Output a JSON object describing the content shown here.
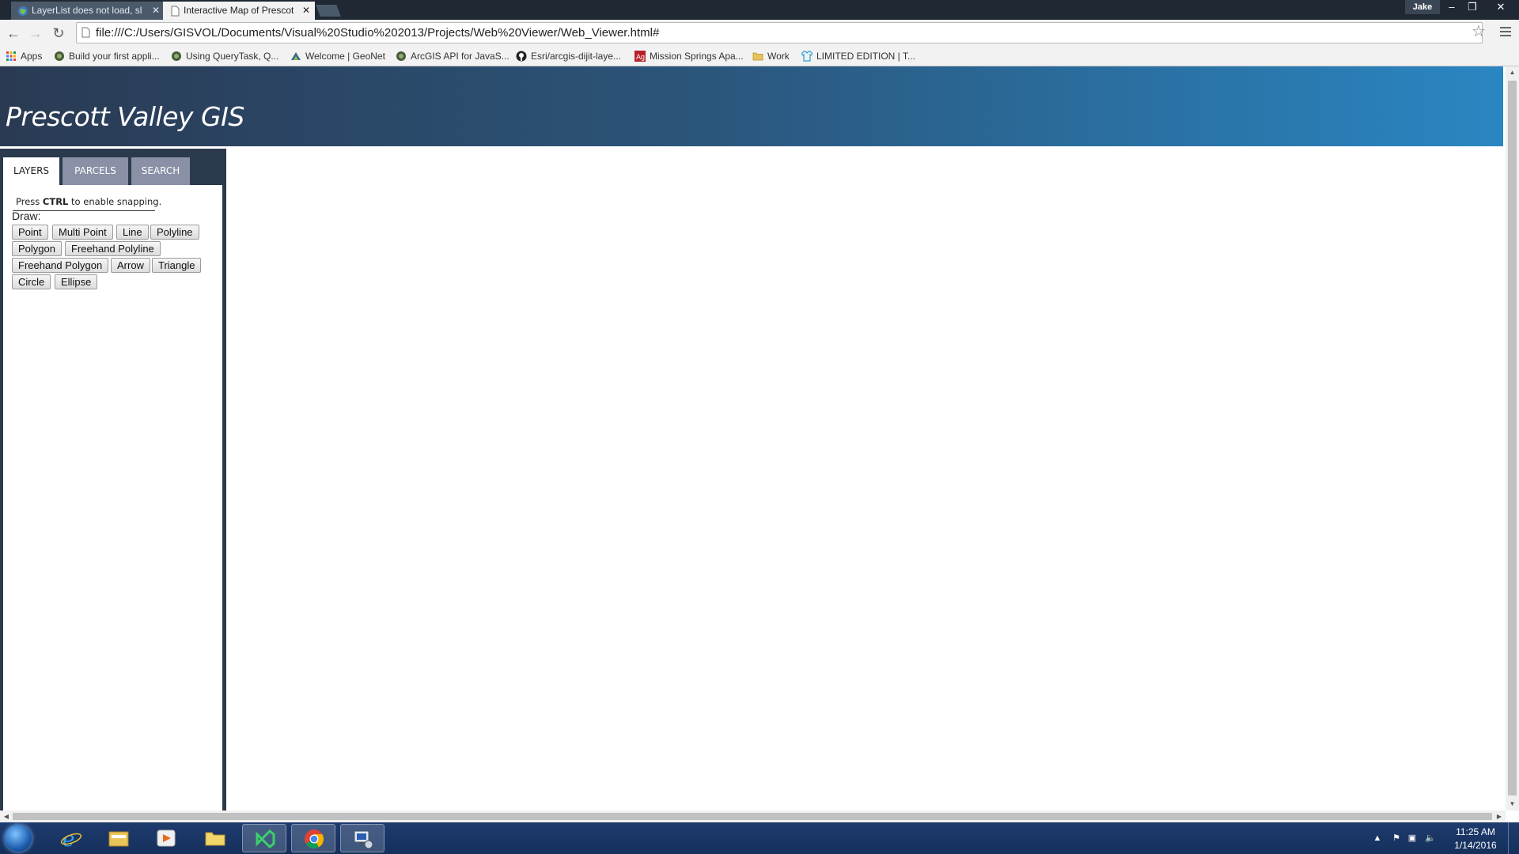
{
  "browser": {
    "tabs": [
      {
        "label": "LayerList does not load, sl"
      },
      {
        "label": "Interactive Map of Prescot"
      }
    ],
    "user": "Jake",
    "url": "file:///C:/Users/GISVOL/Documents/Visual%20Studio%202013/Projects/Web%20Viewer/Web_Viewer.html#",
    "bookmarks": [
      {
        "label": "Apps"
      },
      {
        "label": "Build your first appli..."
      },
      {
        "label": "Using QueryTask, Q..."
      },
      {
        "label": "Welcome | GeoNet"
      },
      {
        "label": "ArcGIS API for JavaS..."
      },
      {
        "label": "Esri/arcgis-dijit-laye..."
      },
      {
        "label": "Mission Springs Apa..."
      },
      {
        "label": "Work"
      },
      {
        "label": "LIMITED EDITION | T..."
      }
    ]
  },
  "page": {
    "title": "Prescott Valley GIS",
    "tabs": [
      {
        "label": "LAYERS"
      },
      {
        "label": "PARCELS"
      },
      {
        "label": "SEARCH"
      }
    ],
    "snap_note": {
      "before": "Press ",
      "key": "CTRL",
      "after": " to enable snapping."
    },
    "draw_label": "Draw:",
    "draw_buttons": [
      {
        "label": "Point"
      },
      {
        "label": "Multi Point"
      },
      {
        "label": "Line"
      },
      {
        "label": "Polyline"
      },
      {
        "label": "Polygon"
      },
      {
        "label": "Freehand Polyline"
      },
      {
        "label": "Freehand Polygon"
      },
      {
        "label": "Arrow"
      },
      {
        "label": "Triangle"
      },
      {
        "label": "Circle"
      },
      {
        "label": "Ellipse"
      }
    ]
  },
  "taskbar": {
    "time": "11:25 AM",
    "date": "1/14/2016"
  },
  "colors": {
    "header_start": "#2a3a53",
    "header_end": "#2a86c2",
    "sidebar": "#2b3a4d",
    "inactive_tab": "#8a90a6"
  }
}
